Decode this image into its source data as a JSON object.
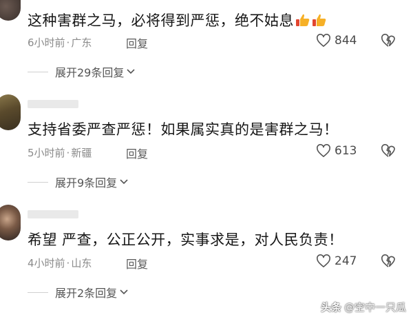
{
  "comments": [
    {
      "text": "这种害群之马，必将得到严惩，绝不姑息",
      "time": "6小时前",
      "region": "广东",
      "reply_label": "回复",
      "likes": "844",
      "expand_label": "展开29条回复"
    },
    {
      "text": "支持省委严查严惩！如果属实真的是害群之马！",
      "time": "5小时前",
      "region": "新疆",
      "reply_label": "回复",
      "likes": "613",
      "expand_label": "展开9条回复"
    },
    {
      "text": "希望 严查，公正公开，实事求是，对人民负责！",
      "time": "4小时前",
      "region": "山东",
      "reply_label": "回复",
      "likes": "247",
      "expand_label": "展开2条回复"
    }
  ],
  "separator": "·",
  "watermark": {
    "brand": "头条",
    "account": "@空中一只瓜"
  },
  "icons": {
    "like": "heart-outline-icon",
    "dislike": "broken-heart-icon",
    "expand": "chevron-down-icon",
    "emoji": "thumbs-up-emoji"
  },
  "colors": {
    "text": "#161616",
    "meta": "#8a8a8a",
    "icon": "#555555"
  }
}
